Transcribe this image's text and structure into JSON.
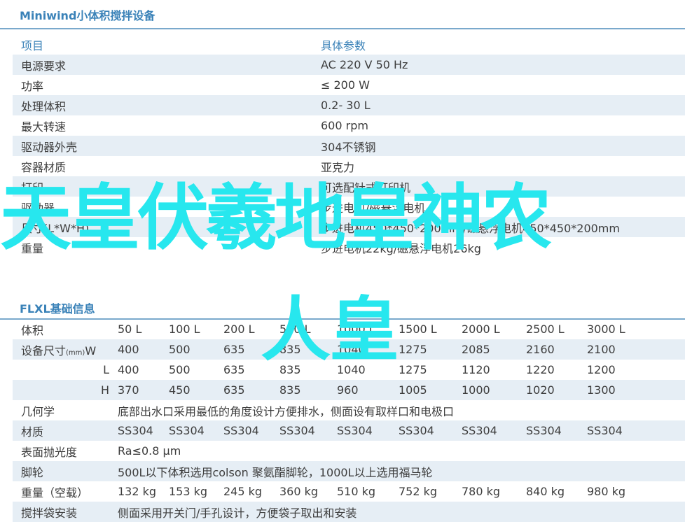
{
  "section1": {
    "title": "Miniwind小体积搅拌设备",
    "header": [
      "项目",
      "具体参数"
    ],
    "rows": [
      [
        "电源要求",
        "AC 220 V 50 Hz"
      ],
      [
        "功率",
        "≤ 200 W"
      ],
      [
        "处理体积",
        "0.2- 30 L"
      ],
      [
        "最大转速",
        "600 rpm"
      ],
      [
        "驱动器外壳",
        "304不锈钢"
      ],
      [
        "容器材质",
        "亚克力"
      ],
      [
        "打印",
        "可选配针式打印机"
      ],
      [
        "驱动器",
        "步进电机/磁悬浮电机"
      ],
      [
        "尺寸(L*W*H)",
        "步进电机450*450*200mm/磁悬浮电机450*450*200mm"
      ],
      [
        "重量",
        "步进电机22kg/磁悬浮电机26kg"
      ]
    ]
  },
  "section2": {
    "title": "FLXL基础信息",
    "volume_label": "体积",
    "volumes": [
      "50 L",
      "100 L",
      "200 L",
      "500 L",
      "1000 L",
      "1500 L",
      "2000 L",
      "2500 L",
      "3000 L"
    ],
    "size_label": "设备尺寸",
    "size_unit": "(mm)",
    "W_label": "W",
    "W": [
      "400",
      "500",
      "635",
      "835",
      "1040",
      "1275",
      "2085",
      "2160",
      "2100"
    ],
    "L_label": "L",
    "L": [
      "400",
      "500",
      "635",
      "835",
      "1040",
      "1275",
      "1120",
      "1220",
      "1200"
    ],
    "H_label": "H",
    "H": [
      "370",
      "450",
      "635",
      "835",
      "960",
      "1005",
      "1000",
      "1020",
      "1300"
    ],
    "geometry_label": "几何学",
    "geometry_text": "底部出水口采用最低的角度设计方便排水，侧面设有取样口和电极口",
    "material_label": "材质",
    "material": [
      "SS304",
      "SS304",
      "SS304",
      "SS304",
      "SS304",
      "SS304",
      "SS304",
      "SS304",
      "SS304"
    ],
    "polish_label": "表面抛光度",
    "polish_text": "Ra≤0.8 μm",
    "wheel_label": "脚轮",
    "wheel_text": "500L以下体积选用colson 聚氨酯脚轮，1000L以上选用福马轮",
    "weight_label": "重量（空载）",
    "weight": [
      "132 kg",
      "153 kg",
      "245 kg",
      "360 kg",
      "510 kg",
      "752 kg",
      "780 kg",
      "840 kg",
      "980 kg"
    ],
    "bag_label": "搅拌袋安装",
    "bag_text": "侧面采用开关门/手孔设计，方便袋子取出和安装"
  },
  "overlay": {
    "line1": "天皇伏羲地皇神农",
    "line2": "人皇"
  },
  "colors": {
    "accent": "#3a82b8",
    "shade": "#e6eef5",
    "overlay": "#27e7ee"
  }
}
